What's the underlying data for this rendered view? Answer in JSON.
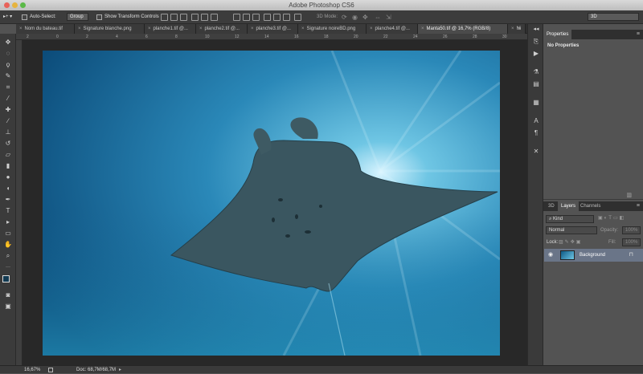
{
  "app": {
    "title": "Adobe Photoshop CS6"
  },
  "options_bar": {
    "auto_select_label": "Auto-Select:",
    "auto_select_value": "Group",
    "transform_label": "Show Transform Controls",
    "mode_label": "3D Mode:",
    "workspace_value": "3D"
  },
  "tabs": [
    {
      "label": "Nom du bateau.tif"
    },
    {
      "label": "Signature blanche.png"
    },
    {
      "label": "planche1.tif @..."
    },
    {
      "label": "planche2.tif @..."
    },
    {
      "label": "planche3.tif @..."
    },
    {
      "label": "Signature noireBD.png"
    },
    {
      "label": "planche4.tif @..."
    },
    {
      "label": "Manta50.tif @ 16,7% (RGB/8)"
    },
    {
      "label": "Ni"
    }
  ],
  "ruler": {
    "ticks": [
      "2",
      "0",
      "2",
      "4",
      "6",
      "8",
      "10",
      "12",
      "14",
      "16",
      "18",
      "20",
      "22",
      "24",
      "26",
      "28",
      "30"
    ]
  },
  "status": {
    "zoom": "16,67%",
    "doc": "Doc: 68,7M/68,7M"
  },
  "properties_panel": {
    "tab": "Properties",
    "empty_text": "No Properties"
  },
  "layers_panel": {
    "tabs": [
      "3D",
      "Layers",
      "Channels"
    ],
    "kind_value": "Kind",
    "blend_value": "Normal",
    "opacity_label": "Opacity:",
    "opacity_value": "100%",
    "lock_label": "Lock:",
    "fill_label": "Fill:",
    "fill_value": "100%",
    "layers": [
      {
        "name": "Background"
      }
    ]
  },
  "colors": {
    "water_deep": "#0c4c78",
    "water_light": "#3ea3c9",
    "manta": "#3b5660"
  }
}
